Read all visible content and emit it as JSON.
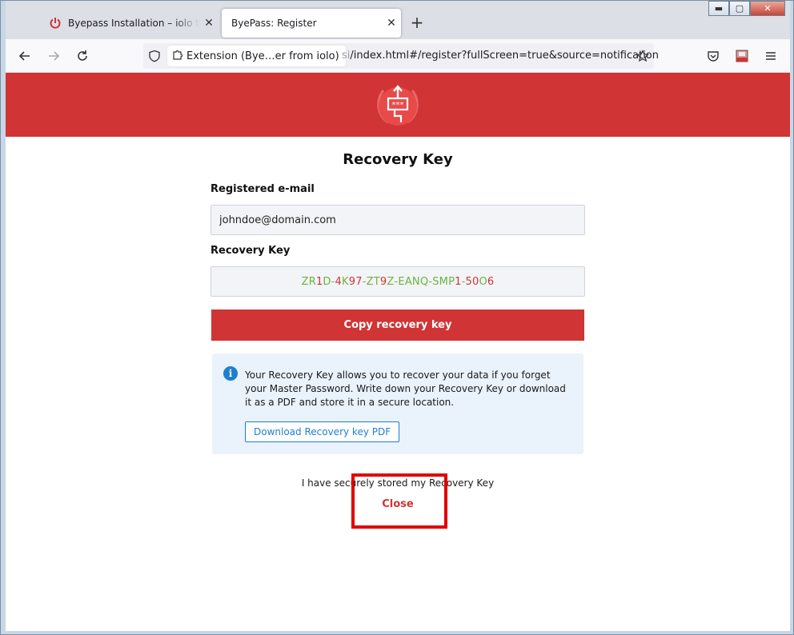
{
  "browser": {
    "tabs": [
      {
        "title": "Byepass Installation – iolo techn",
        "active": false
      },
      {
        "title": "ByePass: Register",
        "active": true
      }
    ],
    "new_tab": "+",
    "url": {
      "extension_label": "Extension (Bye…er from iolo)",
      "faded_part": "si",
      "path": "/index.html#/register?fullScreen=true&source=notification"
    },
    "caption": {
      "minimize": "▬",
      "maximize": "▢",
      "close": "✕"
    }
  },
  "page": {
    "title": "Recovery Key",
    "email_label": "Registered e-mail",
    "email_value": "johndoe@domain.com",
    "recovery_label": "Recovery Key",
    "recovery_key": "ZR1D-4K97-ZT9Z-EANQ-SMP1-50O6",
    "copy_button": "Copy recovery key",
    "info_icon": "i",
    "info_text": "Your Recovery Key allows you to recover your data if you forget your Master Password. Write down your Recovery Key or download it as a PDF and store it in a secure location.",
    "download_button": "Download Recovery key PDF",
    "stored_text": "I have securely stored my Recovery Key",
    "close_link": "Close"
  },
  "colors": {
    "brand_red": "#d03434",
    "key_letter": "#6cb33f",
    "key_digit": "#d03434",
    "info_blue": "#1f7fcf",
    "highlight": "#e00000"
  }
}
